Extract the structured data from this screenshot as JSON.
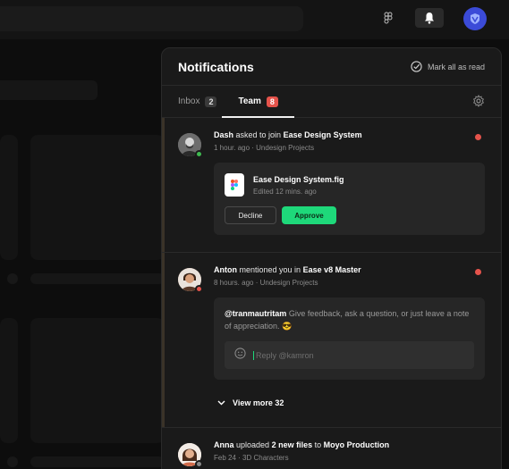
{
  "panel": {
    "title": "Notifications",
    "mark_all_label": "Mark all as read"
  },
  "tabs": [
    {
      "label": "Inbox",
      "count": "2",
      "active": false
    },
    {
      "label": "Team",
      "count": "8",
      "active": true
    }
  ],
  "notifications": [
    {
      "user": "Dash",
      "action": "asked to join",
      "target": "Ease Design System",
      "time": "1 hour. ago",
      "project": "Undesign Projects",
      "status_color": "#3fb950",
      "file": {
        "name": "Ease Design System.fig",
        "meta": "Edited 12 mins. ago"
      },
      "decline_label": "Decline",
      "approve_label": "Approve"
    },
    {
      "user": "Anton",
      "action": "mentioned you in",
      "target": "Ease v8 Master",
      "time": "8 hours. ago",
      "project": "Undesign Projects",
      "status_color": "#e5534b",
      "comment_mention": "@tranmautritam",
      "comment_body": "Give feedback, ask a question, or just leave a note of appreciation. 😎",
      "reply_placeholder": "Reply @kamron",
      "view_more_label": "View more 32"
    },
    {
      "user": "Anna",
      "action": "uploaded",
      "count_text": "2 new files",
      "to": "to",
      "target": "Moyo Production",
      "time": "Feb 24",
      "project": "3D Characters",
      "status_color": "#8a8a8a"
    }
  ],
  "colors": {
    "accent_green": "#1ed87a",
    "unread_red": "#e5534b",
    "panel_bg": "#1a1a1a"
  }
}
